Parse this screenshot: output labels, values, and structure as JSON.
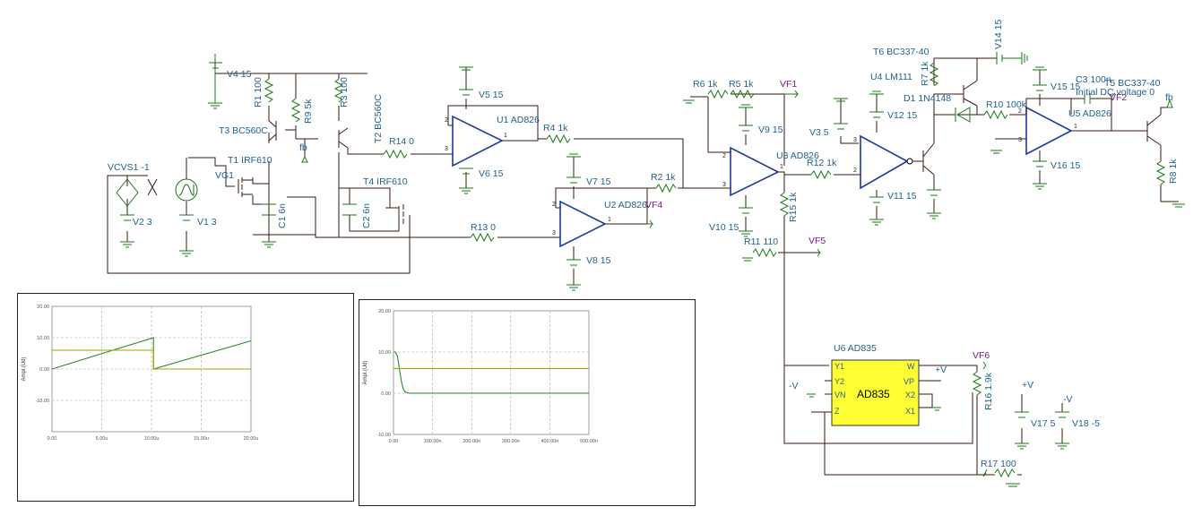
{
  "labels": {
    "v4": "V4 15",
    "r1": "R1 100",
    "r9": "R9 5k",
    "r3": "R3 100",
    "t3": "T3 BC560C",
    "t2": "T2 BC560C",
    "fb1": "fb",
    "t1": "T1 IRF610",
    "vg1": "VG1",
    "vcvs1": "VCVS1 -1",
    "v2": "V2 3",
    "v1": "V1 3",
    "c1": "C1 6n",
    "c2": "C2 6n",
    "t4": "T4 IRF610",
    "r14": "R14 0",
    "r13": "R13 0",
    "u1": "U1 AD826",
    "v5": "V5 15",
    "v6": "V6 15",
    "r4": "R4 1k",
    "v7": "V7 15",
    "u2": "U2 AD826",
    "vf4": "VF4",
    "v8": "V8 15",
    "r2": "R2 1k",
    "r6": "R6 1k",
    "r5": "R5 1k",
    "vf1": "VF1",
    "v9": "V9 15",
    "u3": "U3 AD826",
    "v10": "V10 15",
    "r15": "R15 1k",
    "r11": "R11 110",
    "vf5": "VF5",
    "r12": "R12 1k",
    "v3": "V3 5",
    "u4": "U4 LM111",
    "v12": "V12 15",
    "v11": "V11 15",
    "t6": "T6 BC337-40",
    "r7": "R7 1k",
    "d1": "D1 1N4148",
    "v14": "V14 15",
    "r10": "R10 100k",
    "v15": "V15 15",
    "c3": "C3 100n",
    "c3ic": "Initial DC voltage 0",
    "u5": "U5 AD826",
    "v16": "V16 15",
    "t5": "T5 BC337-40",
    "fb2": "fb",
    "vf2": "VF2",
    "r8": "R8 1k",
    "u6": "U6 AD835",
    "u6body": "AD835",
    "vpos1": "+V",
    "vneg1": "-V",
    "vf6": "VF6",
    "r16": "R16 1.9k",
    "r17": "R17 100",
    "vpos2": "+V",
    "vneg2": "-V",
    "v17": "V17 5",
    "v18": "V18 -5",
    "pin_y1": "Y1",
    "pin_y2": "Y2",
    "pin_vn": "VN",
    "pin_z": "Z",
    "pin_w": "W",
    "pin_vp": "VP",
    "pin_x2": "X2",
    "pin_x1": "X1"
  },
  "chart_data": [
    {
      "type": "line",
      "title": "",
      "xlabel": "",
      "ylabel": "Ampl.(Ud)",
      "xlim": [
        0,
        20
      ],
      "ylim": [
        -20,
        20
      ],
      "x_ticks": [
        "0.00",
        "5.00u",
        "10.00u",
        "15.00u",
        "20.00u"
      ],
      "y_ticks": [
        "20.00",
        "10.00",
        "0.00",
        "-10.00"
      ],
      "series": [
        {
          "color": "#2a8a2a",
          "x": [
            0,
            10.2,
            10.2,
            20
          ],
          "y": [
            0,
            10,
            0,
            9
          ]
        },
        {
          "color": "#a8a000",
          "x": [
            0,
            10.2,
            10.2,
            20
          ],
          "y": [
            6,
            6,
            0,
            0
          ]
        }
      ]
    },
    {
      "type": "line",
      "title": "",
      "xlabel": "",
      "ylabel": "Ampl.(Ud)",
      "xlim": [
        0,
        500
      ],
      "ylim": [
        -10,
        20
      ],
      "x_ticks": [
        "0.00",
        "100.00n",
        "200.00n",
        "300.00n",
        "400.00n",
        "500.00n"
      ],
      "y_ticks": [
        "20.00",
        "10.00",
        "0.00",
        "-10.00"
      ],
      "series": [
        {
          "color": "#2a8a2a",
          "x": [
            0,
            5,
            10,
            15,
            20,
            25,
            30,
            40,
            60,
            500
          ],
          "y": [
            10,
            10,
            9,
            6,
            3,
            1,
            0.3,
            0,
            0,
            0
          ]
        },
        {
          "color": "#a8a000",
          "x": [
            0,
            500
          ],
          "y": [
            6,
            6
          ]
        }
      ]
    }
  ]
}
